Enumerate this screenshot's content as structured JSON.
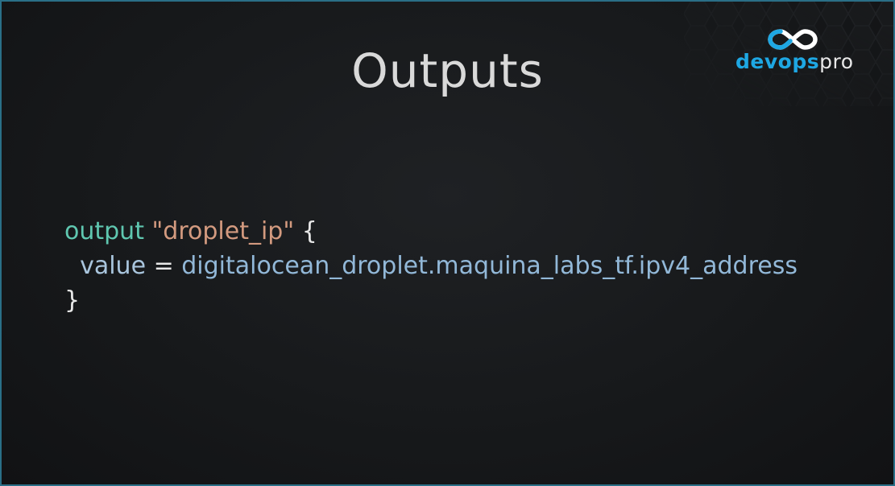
{
  "slide": {
    "title": "Outputs"
  },
  "logo": {
    "brand_part1": "devops",
    "brand_part2": "pro",
    "mark_icon": "infinity-loop-icon"
  },
  "code": {
    "line1": {
      "keyword": "output",
      "string": "\"droplet_ip\"",
      "brace_open": "{"
    },
    "line2": {
      "attribute": "value",
      "operator": "=",
      "reference": "digitalocean_droplet.maquina_labs_tf.ipv4_address"
    },
    "line3": {
      "brace_close": "}"
    }
  },
  "colors": {
    "keyword": "#5fc7b0",
    "string": "#d39a7f",
    "reference": "#92b8d8",
    "border_accent": "#2a6f87",
    "logo_blue": "#1ea7e3"
  }
}
